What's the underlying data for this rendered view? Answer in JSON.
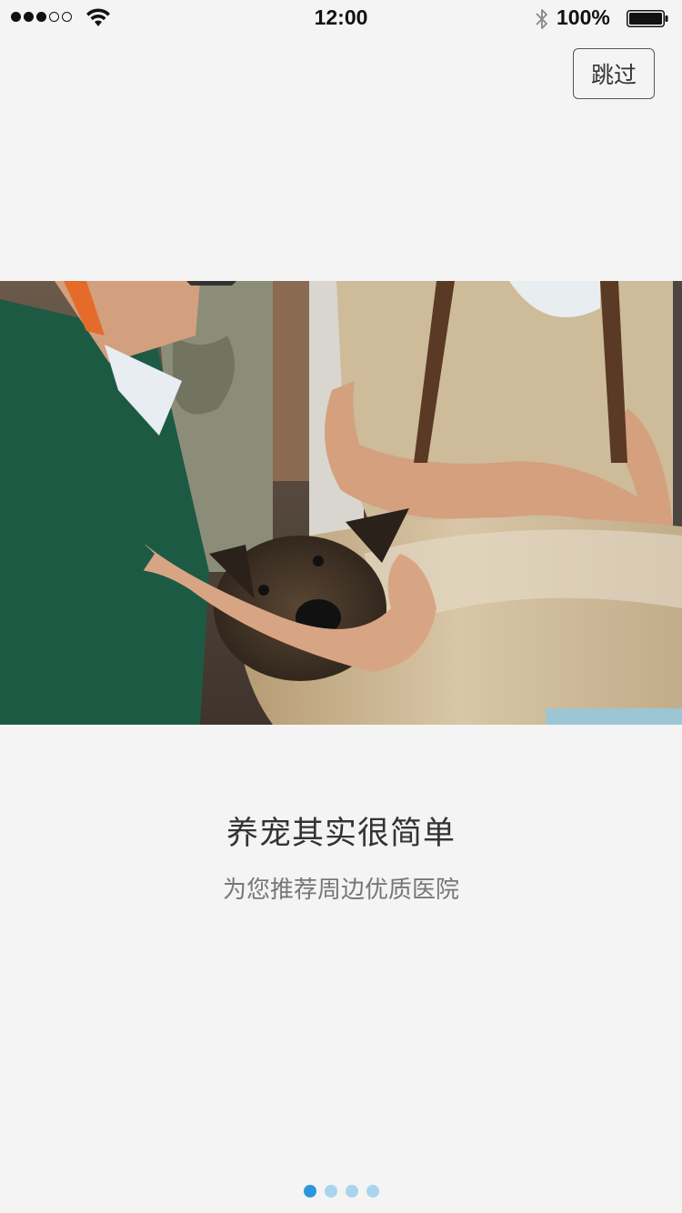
{
  "status_bar": {
    "time": "12:00",
    "battery_percent": "100%",
    "signal_bars_filled": 3,
    "signal_bars_total": 5
  },
  "skip_button": {
    "label": "跳过"
  },
  "hero": {
    "subject": "veterinarian-with-dog-photo"
  },
  "content": {
    "title": "养宠其实很简单",
    "subtitle": "为您推荐周边优质医院"
  },
  "pager": {
    "total": 4,
    "active_index": 0,
    "colors": {
      "active": "#2a97dd",
      "inactive": "#a9d4ee"
    }
  }
}
